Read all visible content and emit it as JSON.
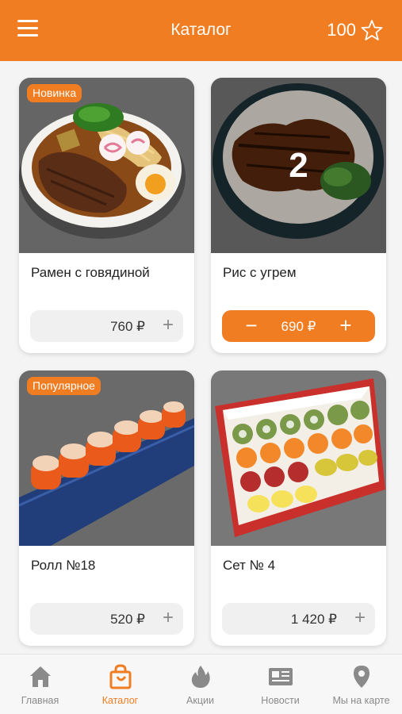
{
  "header": {
    "menu_icon": "hamburger-menu-icon",
    "title": "Каталог",
    "points": "100",
    "points_icon": "star-icon"
  },
  "products": [
    {
      "name": "Рамен с говядиной",
      "price": "760 ₽",
      "badge": "Новинка",
      "in_cart": false
    },
    {
      "name": "Рис с угрем",
      "price": "690 ₽",
      "in_cart": true,
      "quantity": "2"
    },
    {
      "name": "Ролл №18",
      "price": "520 ₽",
      "badge": "Популярное",
      "in_cart": false
    },
    {
      "name": "Сет № 4",
      "price": "1 420 ₽",
      "in_cart": false
    }
  ],
  "tabbar": {
    "tabs": [
      {
        "label": "Главная",
        "icon": "home-icon"
      },
      {
        "label": "Каталог",
        "icon": "shopping-bag-icon",
        "active": true
      },
      {
        "label": "Акции",
        "icon": "flame-icon"
      },
      {
        "label": "Новости",
        "icon": "newspaper-icon"
      },
      {
        "label": "Мы на карте",
        "icon": "map-pin-icon"
      }
    ]
  },
  "colors": {
    "accent": "#f07d22",
    "inactive": "#8a8a8a"
  }
}
